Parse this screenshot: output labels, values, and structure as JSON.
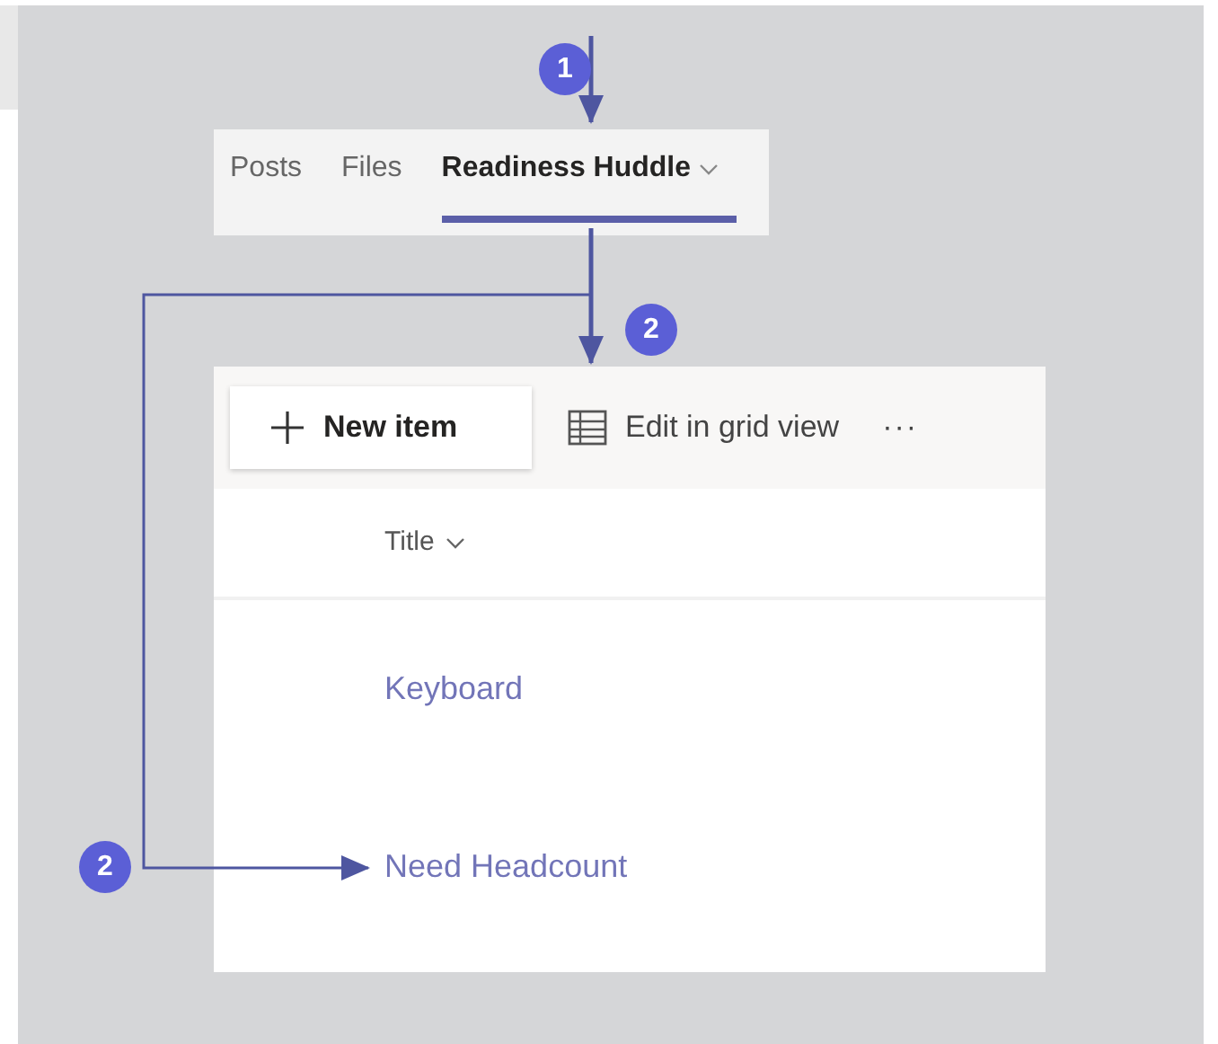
{
  "tabs": [
    {
      "label": "Posts",
      "selected": false,
      "dropdown": false
    },
    {
      "label": "Files",
      "selected": false,
      "dropdown": false
    },
    {
      "label": "Readiness Huddle",
      "selected": true,
      "dropdown": true
    }
  ],
  "toolbar": {
    "new_item": "New item",
    "grid_view": "Edit in grid view",
    "more": "···"
  },
  "list": {
    "columns": [
      {
        "label": "Title"
      }
    ],
    "rows": [
      {
        "title": "Keyboard"
      },
      {
        "title": "Need Headcount"
      }
    ]
  },
  "callouts": [
    {
      "number": "1"
    },
    {
      "number": "2"
    },
    {
      "number": "2"
    }
  ]
}
